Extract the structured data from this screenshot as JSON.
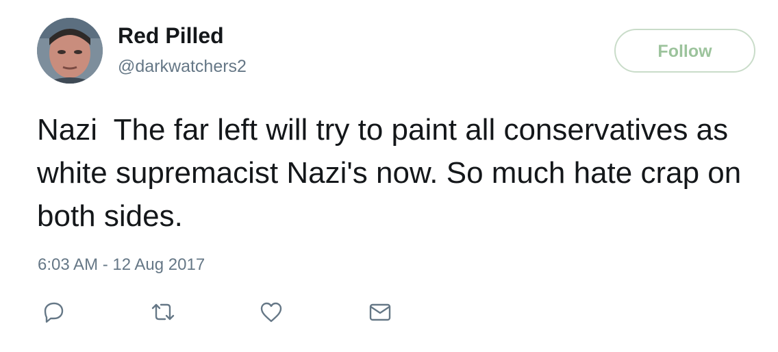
{
  "user": {
    "display_name": "Red Pilled",
    "handle": "@darkwatchers2"
  },
  "follow_button": {
    "label": "Follow",
    "color": "#9cc39c"
  },
  "tweet": {
    "text": "Nazi  The far left will try to paint all conservatives as white supremacist Nazi's now. So much hate crap on both sides.",
    "timestamp": "6:03 AM - 12 Aug 2017"
  },
  "actions": [
    {
      "icon": "reply-icon"
    },
    {
      "icon": "retweet-icon"
    },
    {
      "icon": "like-icon"
    },
    {
      "icon": "direct-message-icon"
    }
  ],
  "colors": {
    "text": "#14171a",
    "secondary": "#657786",
    "icon": "#657786"
  }
}
